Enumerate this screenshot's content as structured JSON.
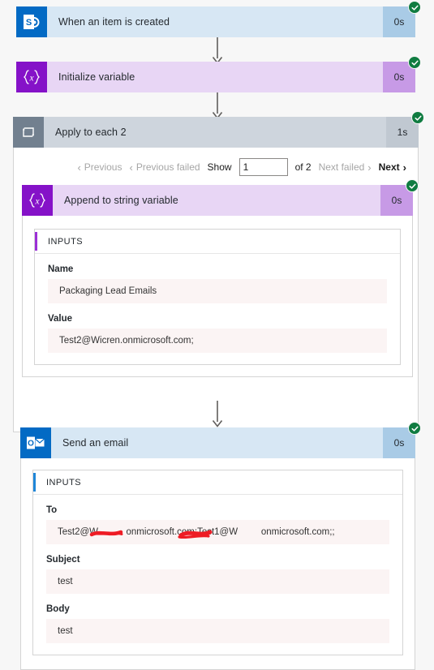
{
  "flow": {
    "steps": [
      {
        "id": "when-item-created",
        "title": "When an item is created",
        "duration": "0s",
        "status": "succeeded",
        "icon": "sharepoint-icon"
      },
      {
        "id": "initialize-variable",
        "title": "Initialize variable",
        "duration": "0s",
        "status": "succeeded",
        "icon": "variable-icon"
      },
      {
        "id": "apply-to-each-2",
        "title": "Apply to each 2",
        "duration": "1s",
        "status": "succeeded",
        "icon": "loop-icon"
      },
      {
        "id": "append-to-string-variable",
        "title": "Append to string variable",
        "duration": "0s",
        "status": "succeeded",
        "icon": "variable-icon"
      },
      {
        "id": "send-an-email",
        "title": "Send an email",
        "duration": "0s",
        "status": "succeeded",
        "icon": "outlook-icon"
      }
    ]
  },
  "pager": {
    "previous": "Previous",
    "previous_failed": "Previous failed",
    "show_label": "Show",
    "page_value": "1",
    "of_label": "of 2",
    "next_failed": "Next failed",
    "next": "Next",
    "chevron_left": "‹",
    "chevron_right": "›"
  },
  "append_inputs": {
    "header": "INPUTS",
    "name_label": "Name",
    "name_value": "Packaging Lead Emails",
    "value_label": "Value",
    "value_value": "Test2@Wicren.onmicrosoft.com;"
  },
  "email_inputs": {
    "header": "INPUTS",
    "to_label": "To",
    "to_value_part1": "Test2@W",
    "to_value_part2": "onmicrosoft.com;Test1@W",
    "to_value_part3": "onmicrosoft.com;;",
    "subject_label": "Subject",
    "subject_value": "test",
    "body_label": "Body",
    "body_value": "test"
  },
  "colors": {
    "sharepoint": "#036ac4",
    "variable": "#8512c8",
    "loop": "#72808f",
    "outlook": "#036ac4",
    "success": "#107c41",
    "redaction": "#ee1c25",
    "page_background": "#f7f7f7"
  }
}
